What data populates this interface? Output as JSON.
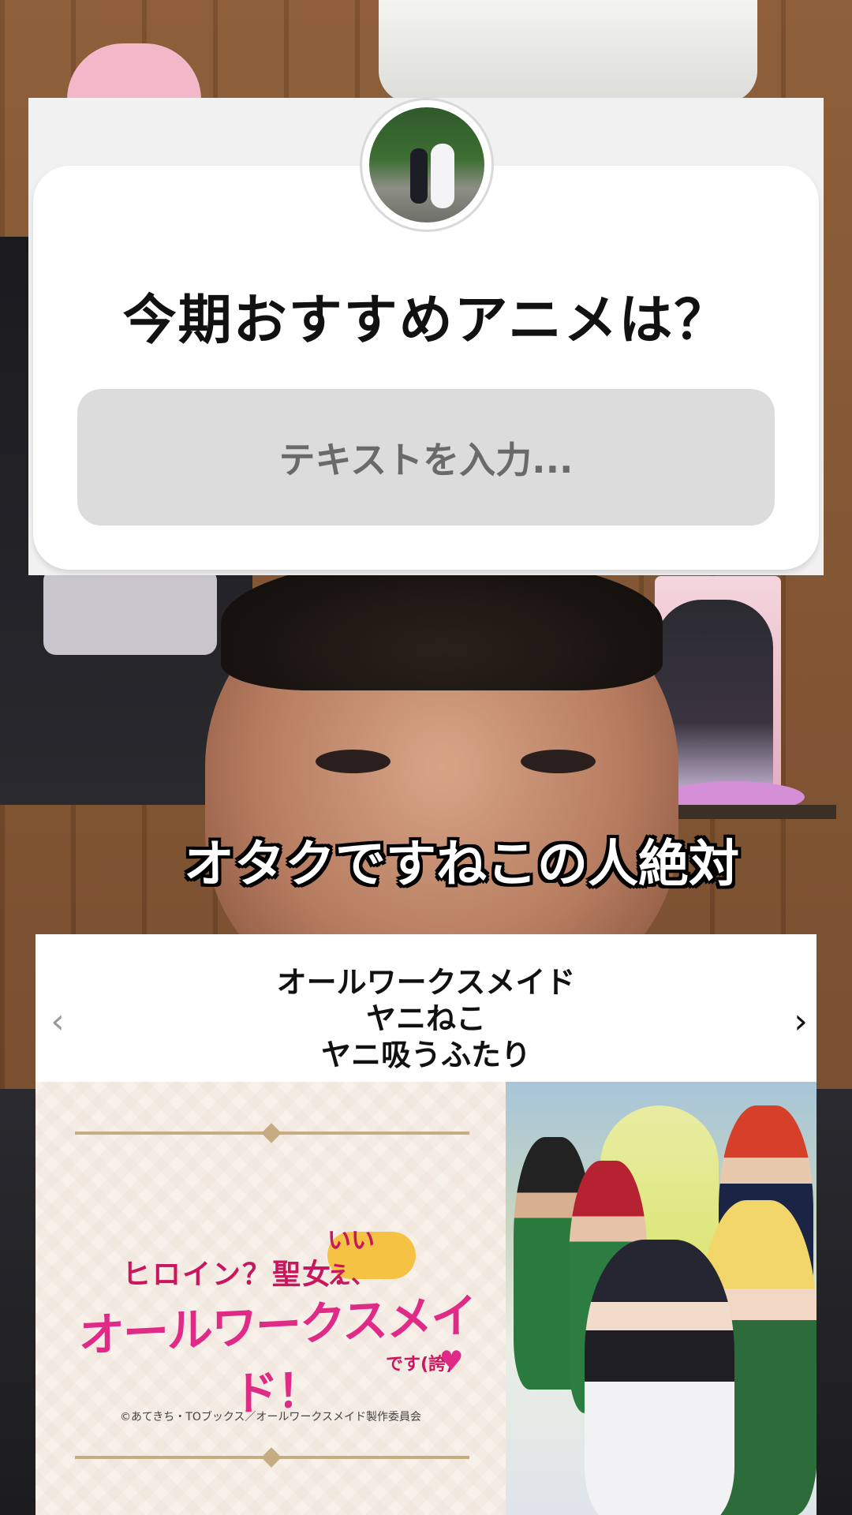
{
  "question_sticker": {
    "title": "今期おすすめアニメは？",
    "input_placeholder": "テキストを入力..."
  },
  "caption": "オタクですねこの人絶対",
  "anime_card": {
    "titles": [
      "オールワークスメイド",
      "ヤニねこ",
      "ヤニ吸うふたり"
    ],
    "prev_icon": "chevron-left-icon",
    "next_icon": "chevron-right-icon",
    "prev_glyph": "‹",
    "next_glyph": "›",
    "logo": {
      "sub": "ヒロイン？聖女？",
      "bubble": "いいえ、",
      "main": "オールワークスメイド！",
      "tail": "です(誇)",
      "heart": "♥"
    },
    "copyright": "©あてきち・TOブックス／オールワークスメイド製作委員会"
  },
  "colors": {
    "logo_pink": "#e02a87",
    "logo_magenta": "#c9175f",
    "ornament_gold": "#c6ac82"
  }
}
